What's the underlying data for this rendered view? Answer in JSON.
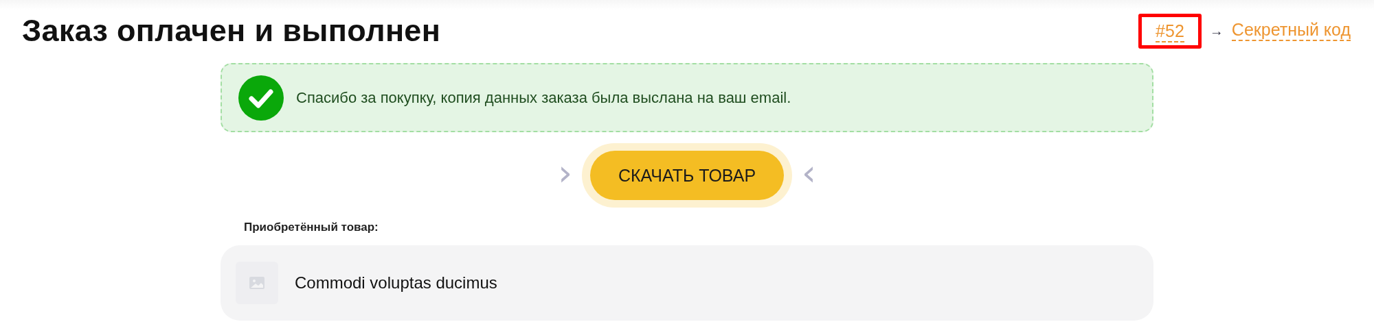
{
  "header": {
    "title": "Заказ оплачен и выполнен",
    "order_number": {
      "text": "#52",
      "highlighted": true
    },
    "arrow": "→",
    "secret_link": "Секретный код"
  },
  "notice": {
    "text": "Спасибо за покупку, копия данных заказа была выслана на ваш email."
  },
  "download": {
    "label": "СКАЧАТЬ ТОВАР",
    "left_chevron": "›",
    "right_chevron": "‹"
  },
  "purchased": {
    "label": "Приобретённый товар:",
    "items": [
      {
        "name": "Commodi voluptas ducimus"
      }
    ]
  }
}
